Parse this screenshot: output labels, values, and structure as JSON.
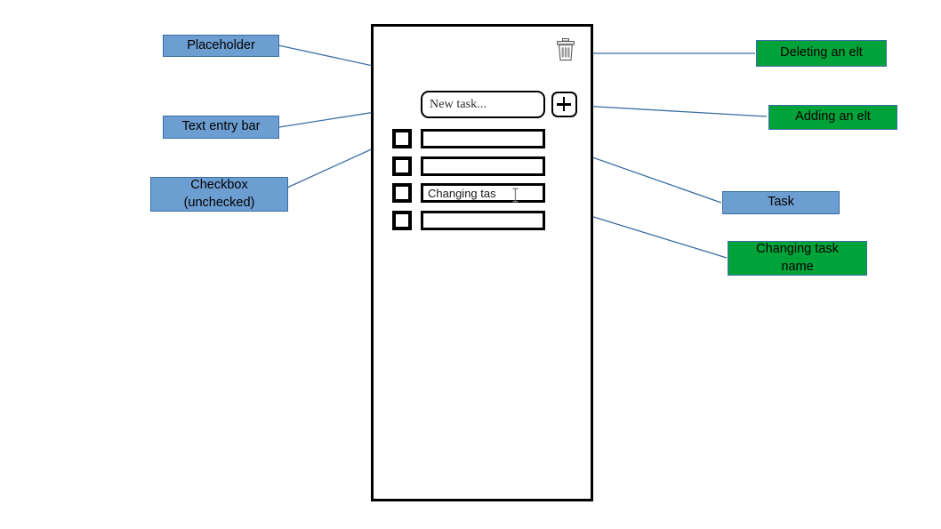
{
  "diagram": {
    "title": "Todo list app UI mockup with annotations",
    "colors": {
      "annotation_blue": "#6d9ed1",
      "annotation_green": "#00a339",
      "annotation_border": "#3b6ea5",
      "connector": "#3b6ea5",
      "frame": "#000000",
      "background": "#ffffff"
    }
  },
  "phone": {
    "toolbar": {
      "delete_icon": "trash-icon",
      "add_icon": "plus-icon"
    },
    "new_task_input": {
      "placeholder": "New task...",
      "value": ""
    },
    "tasks": [
      {
        "checked": false,
        "text": ""
      },
      {
        "checked": false,
        "text": ""
      },
      {
        "checked": false,
        "text": "Changing tas",
        "editing": true,
        "caret_icon": "i-beam-cursor"
      },
      {
        "checked": false,
        "text": ""
      }
    ]
  },
  "annotations": {
    "left": [
      {
        "label": "Placeholder",
        "color": "blue"
      },
      {
        "label": "Text entry bar",
        "color": "blue"
      },
      {
        "label": "Checkbox\n(unchecked)",
        "color": "blue",
        "line1": "Checkbox",
        "line2": "(unchecked)"
      }
    ],
    "right": [
      {
        "label": "Deleting an elt",
        "color": "green"
      },
      {
        "label": "Adding an elt",
        "color": "green"
      },
      {
        "label": "Task",
        "color": "blue"
      },
      {
        "label": "Changing task\nname",
        "color": "green",
        "line1": "Changing task",
        "line2": "name"
      }
    ]
  }
}
